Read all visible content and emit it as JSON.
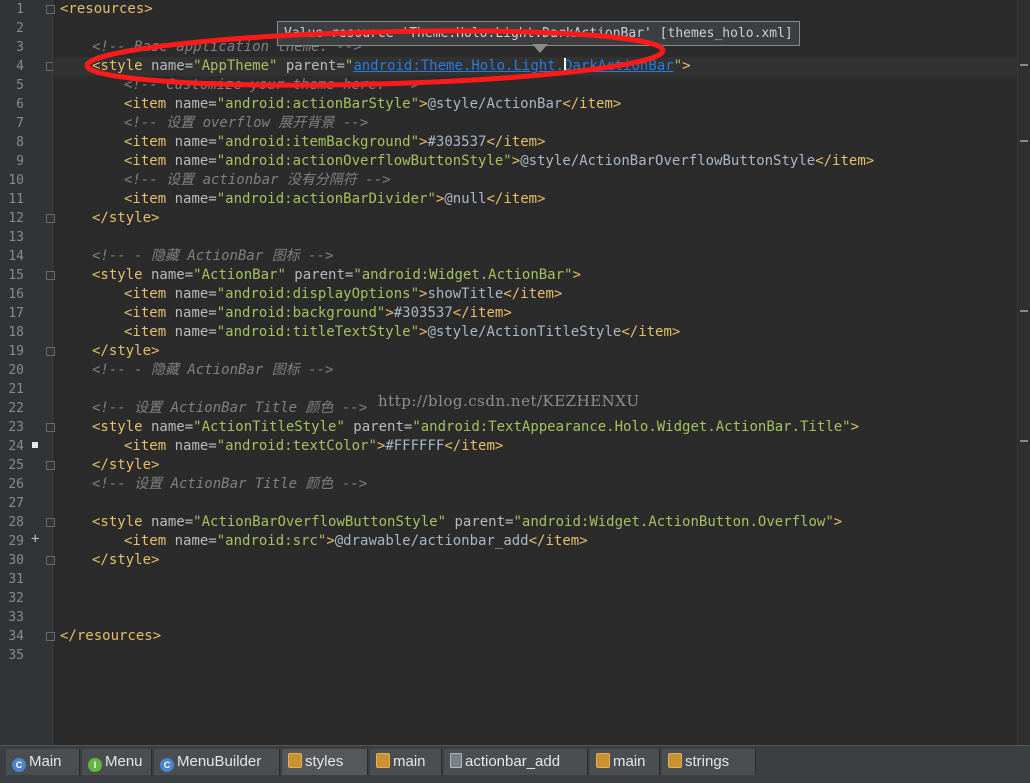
{
  "tooltip": {
    "text": "Value resource 'Theme.Holo.Light.DarkActionBar' [themes_holo.xml]"
  },
  "watermark": "http://blog.csdn.net/KEZHENXU",
  "colors": {
    "tag": "#e8bf6a",
    "attr_name": "#bababa",
    "attr_value": "#a5c25c",
    "comment": "#808080",
    "link": "#287bde",
    "highlight_oval": "#ff1a1a"
  },
  "line_numbers": [
    "1",
    "2",
    "3",
    "4",
    "5",
    "6",
    "7",
    "8",
    "9",
    "10",
    "11",
    "12",
    "13",
    "14",
    "15",
    "16",
    "17",
    "18",
    "19",
    "20",
    "21",
    "22",
    "23",
    "24",
    "25",
    "26",
    "27",
    "28",
    "29",
    "30",
    "31",
    "32",
    "33",
    "34",
    "35"
  ],
  "code": {
    "l1": [
      "<resources>"
    ],
    "l3": [
      "<!-- Base application theme. -->"
    ],
    "l4": [
      "<style",
      " name=",
      "\"AppTheme\"",
      " parent=",
      "\"",
      "android:Theme.Holo.Light.DarkActionBar",
      "\"",
      ">"
    ],
    "l5": [
      "<!-- Customize your theme here. -->"
    ],
    "l6": [
      "<item",
      " name=",
      "\"android:actionBarStyle\"",
      ">",
      "@style/ActionBar",
      "</item>"
    ],
    "l7": [
      "<!-- 设置 overflow 展开背景 -->"
    ],
    "l8": [
      "<item",
      " name=",
      "\"android:itemBackground\"",
      ">",
      "#303537",
      "</item>"
    ],
    "l9": [
      "<item",
      " name=",
      "\"android:actionOverflowButtonStyle\"",
      ">",
      "@style/ActionBarOverflowButtonStyle",
      "</item>"
    ],
    "l10": [
      "<!-- 设置 actionbar 没有分隔符 -->"
    ],
    "l11": [
      "<item",
      " name=",
      "\"android:actionBarDivider\"",
      ">",
      "@null",
      "</item>"
    ],
    "l12": [
      "</style>"
    ],
    "l14": [
      "<!-- - 隐藏 ActionBar 图标 -->"
    ],
    "l15": [
      "<style",
      " name=",
      "\"ActionBar\"",
      " parent=",
      "\"android:Widget.ActionBar\"",
      ">"
    ],
    "l16": [
      "<item",
      " name=",
      "\"android:displayOptions\"",
      ">",
      "showTitle",
      "</item>"
    ],
    "l17": [
      "<item",
      " name=",
      "\"android:background\"",
      ">",
      "#303537",
      "</item>"
    ],
    "l18": [
      "<item",
      " name=",
      "\"android:titleTextStyle\"",
      ">",
      "@style/ActionTitleStyle",
      "</item>"
    ],
    "l19": [
      "</style>"
    ],
    "l20": [
      "<!-- - 隐藏 ActionBar 图标 -->"
    ],
    "l22": [
      "<!-- 设置 ActionBar Title 颜色 -->"
    ],
    "l23": [
      "<style",
      " name=",
      "\"ActionTitleStyle\"",
      " parent=",
      "\"android:TextAppearance.Holo.Widget.ActionBar.Title\"",
      ">"
    ],
    "l24": [
      "<item",
      " name=",
      "\"android:textColor\"",
      ">",
      "#FFFFFF",
      "</item>"
    ],
    "l25": [
      "</style>"
    ],
    "l26": [
      "<!-- 设置 ActionBar Title 颜色 -->"
    ],
    "l28": [
      "<style",
      " name=",
      "\"ActionBarOverflowButtonStyle\"",
      " parent=",
      "\"android:Widget.ActionButton.Overflow\"",
      ">"
    ],
    "l29": [
      "<item",
      " name=",
      "\"android:src\"",
      ">",
      "@drawable/actionbar_add",
      "</item>"
    ],
    "l30": [
      "</style>"
    ],
    "l34": [
      "</resources>"
    ]
  },
  "tabs": [
    {
      "label": "Main",
      "icon": "class-icon"
    },
    {
      "label": "Menu",
      "icon": "interface-icon"
    },
    {
      "label": "MenuBuilder",
      "icon": "class-icon"
    },
    {
      "label": "styles",
      "icon": "xml-icon"
    },
    {
      "label": "main",
      "icon": "xml-icon"
    },
    {
      "label": "actionbar_add",
      "icon": "file-icon"
    },
    {
      "label": "main",
      "icon": "xml-icon"
    },
    {
      "label": "strings",
      "icon": "xml-icon"
    }
  ]
}
